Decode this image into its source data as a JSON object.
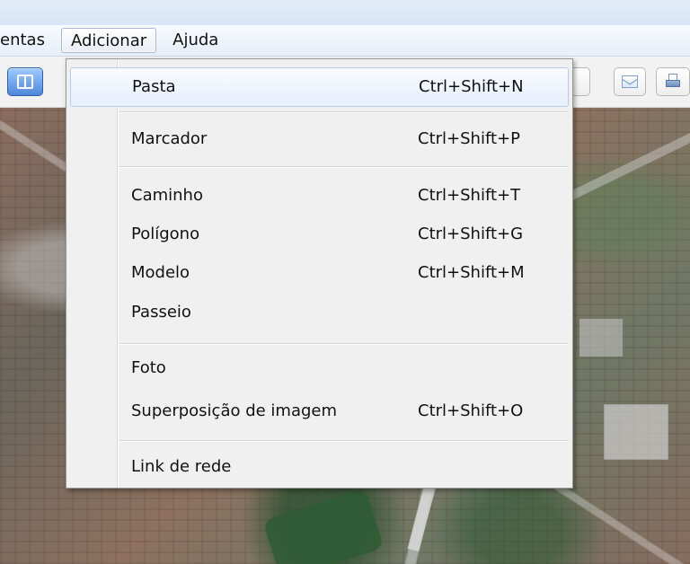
{
  "menubar": {
    "items": [
      {
        "label": "entas"
      },
      {
        "label": "Adicionar"
      },
      {
        "label": "Ajuda"
      }
    ]
  },
  "toolbar": {
    "icons": [
      "sidebar-toggle-icon",
      "envelope-icon",
      "printer-icon"
    ]
  },
  "dropdown": {
    "items": [
      {
        "label": "Pasta",
        "shortcut": "Ctrl+Shift+N"
      },
      {
        "label": "Marcador",
        "shortcut": "Ctrl+Shift+P"
      },
      {
        "label": "Caminho",
        "shortcut": "Ctrl+Shift+T"
      },
      {
        "label": "Polígono",
        "shortcut": "Ctrl+Shift+G"
      },
      {
        "label": "Modelo",
        "shortcut": "Ctrl+Shift+M"
      },
      {
        "label": "Passeio",
        "shortcut": ""
      },
      {
        "label": "Foto",
        "shortcut": ""
      },
      {
        "label": "Superposição de imagem",
        "shortcut": "Ctrl+Shift+O"
      },
      {
        "label": "Link de rede",
        "shortcut": ""
      }
    ]
  },
  "colors": {
    "menu_bg": "#f0f0f0",
    "menu_border": "#979797",
    "highlight": "#e6effc",
    "toolbar_accent": "#4f86d9"
  }
}
